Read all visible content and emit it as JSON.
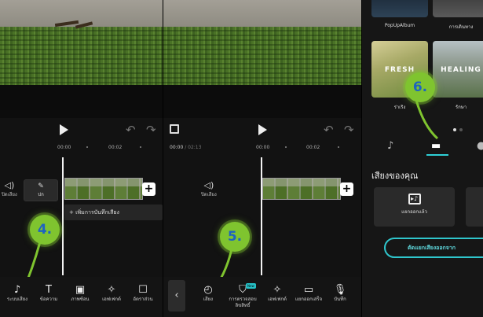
{
  "panel1": {
    "ruler": [
      "00:00",
      "00:02"
    ],
    "track_label": "ปิดเสียง",
    "cover_label": "ปก",
    "add_audio_label": "+ เพิ่มการบันทึกเสียง",
    "step_marker": "4.",
    "tools": [
      {
        "icon": "♪",
        "label": "ระบบเสียง"
      },
      {
        "icon": "T",
        "label": "ข้อความ"
      },
      {
        "icon": "▣",
        "label": "ภาพซ้อน"
      },
      {
        "icon": "✧",
        "label": "เอฟเฟกต์"
      },
      {
        "icon": "☐",
        "label": "อัตราส่วน"
      }
    ]
  },
  "panel2": {
    "timecode_current": "00:00",
    "timecode_total": " / 02:13",
    "ruler": [
      "00:00",
      "00:02"
    ],
    "track_label": "ปิดเสียง",
    "step_marker": "5.",
    "new_badge": "New",
    "tools": [
      {
        "icon": "◴",
        "label": "เสียง"
      },
      {
        "icon": "⛉",
        "label": "การตรวจสอบลิขสิทธิ์"
      },
      {
        "icon": "✧",
        "label": "เอฟเฟกต์"
      },
      {
        "icon": "▭",
        "label": "แยกออกเสร็จ"
      },
      {
        "icon": "🎙",
        "label": "บันทึก"
      }
    ]
  },
  "panel3": {
    "albums_top": [
      "PopUpAlbum",
      "การเดินทาง"
    ],
    "albums": [
      {
        "title": "FRESH",
        "label": "ร่าเริง"
      },
      {
        "title": "HEALING",
        "label": "รักษา"
      }
    ],
    "step_marker": "6.",
    "section_title": "เสียงของคุณ",
    "extract_card_label": "แยกออกแล้ว",
    "extract_button": "ตัดแยกเสียงออกจาก",
    "accent": "#2fd0d6",
    "marker_color": "#7fc42f"
  }
}
